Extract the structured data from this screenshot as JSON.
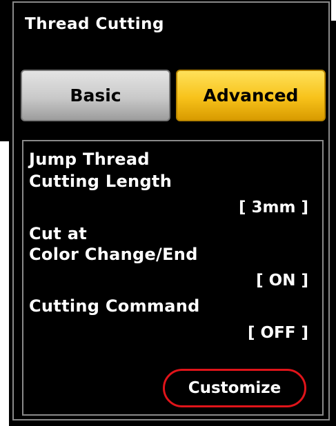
{
  "window": {
    "title": "Thread Cutting"
  },
  "tabs": {
    "basic_label": "Basic",
    "advanced_label": "Advanced",
    "selected": "Advanced"
  },
  "settings": [
    {
      "label_line1": "Jump Thread",
      "label_line2": "Cutting Length",
      "value": "[ 3mm ]"
    },
    {
      "label_line1": "Cut at",
      "label_line2": "Color Change/End",
      "value": "[ ON ]"
    },
    {
      "label_line1": "Cutting Command",
      "value": "[ OFF ]"
    }
  ],
  "actions": {
    "customize_label": "Customize"
  },
  "colors": {
    "background": "#000000",
    "text": "#ffffff",
    "tab_inactive": "#c9c9c9",
    "tab_active": "#f7c21a",
    "customize_border": "#e0141a",
    "frame_border": "#8a8a8a"
  }
}
